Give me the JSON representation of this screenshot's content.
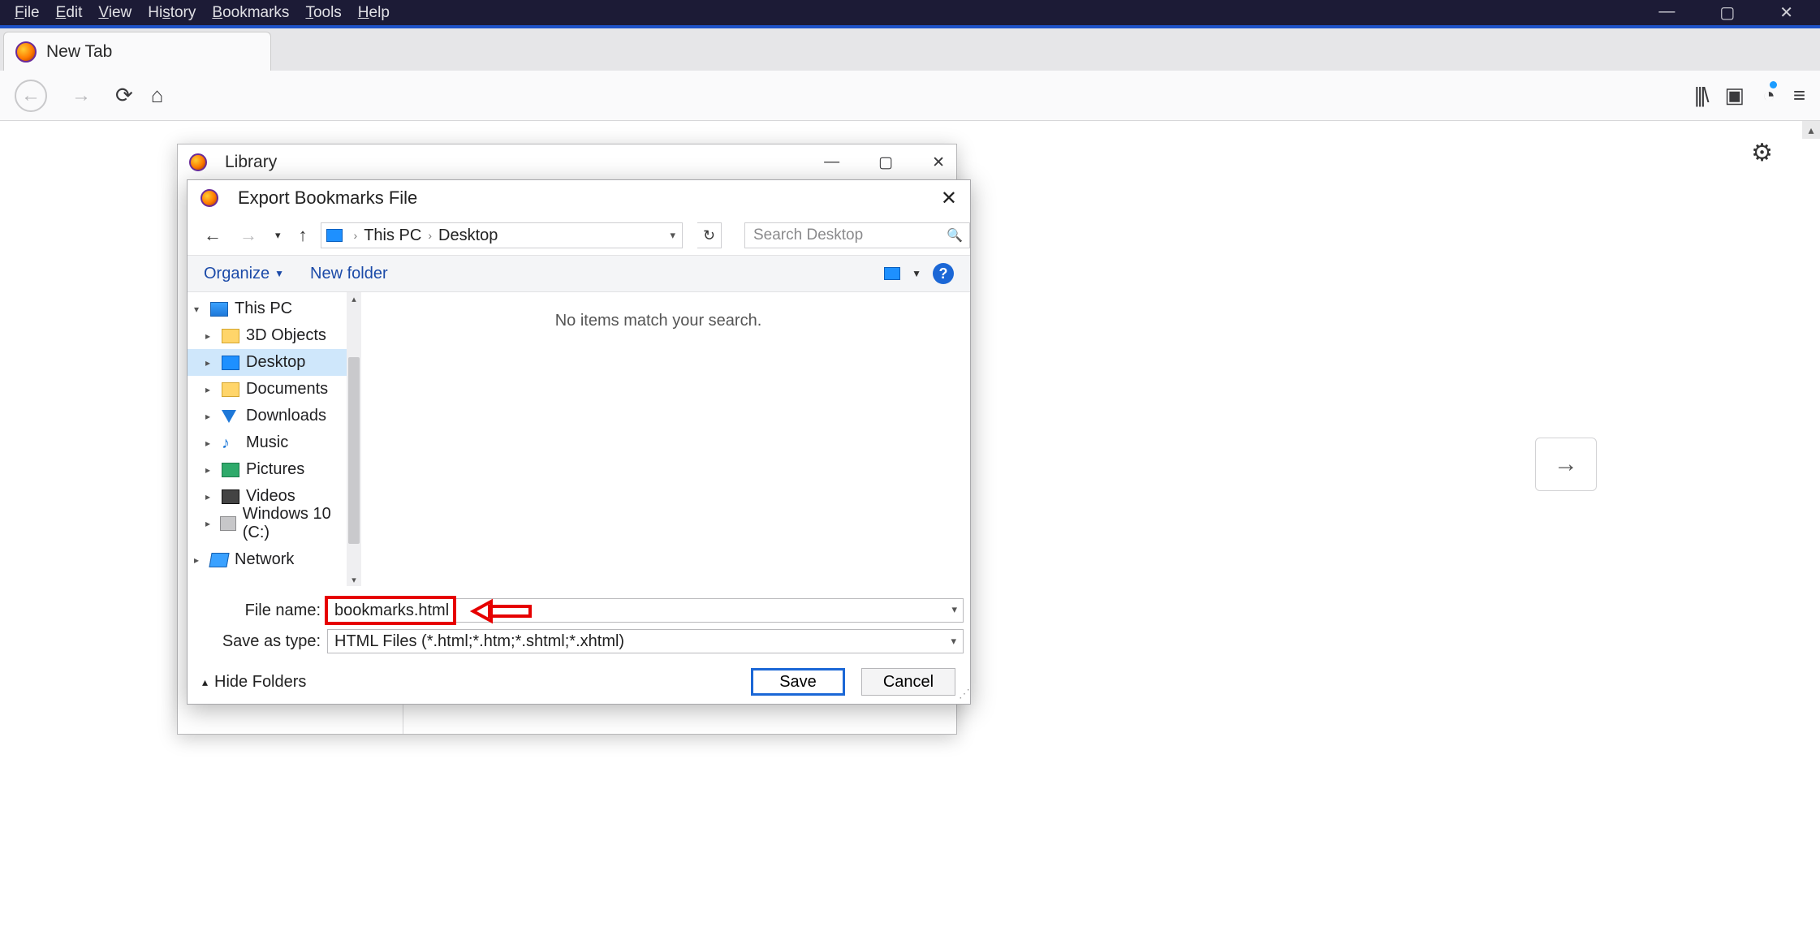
{
  "menubar": {
    "file": "File",
    "edit": "Edit",
    "view": "View",
    "history": "History",
    "bookmarks": "Bookmarks",
    "tools": "Tools",
    "help": "Help"
  },
  "sys": {
    "min": "—",
    "max": "▢",
    "close": "✕"
  },
  "tab": {
    "title": "New Tab"
  },
  "library": {
    "title": "Library",
    "sys": {
      "min": "—",
      "max": "▢",
      "close": "✕"
    }
  },
  "export": {
    "title": "Export Bookmarks File",
    "breadcrumb": {
      "pc": "This PC",
      "desktop": "Desktop"
    },
    "search_placeholder": "Search Desktop",
    "toolbar": {
      "organize": "Organize",
      "newfolder": "New folder"
    },
    "tree": {
      "thispc": "This PC",
      "items": [
        "3D Objects",
        "Desktop",
        "Documents",
        "Downloads",
        "Music",
        "Pictures",
        "Videos",
        "Windows 10 (C:)"
      ],
      "network": "Network"
    },
    "empty": "No items match your search.",
    "form": {
      "filename_label": "File name:",
      "filename_value": "bookmarks.html",
      "saveastype_label": "Save as type:",
      "saveastype_value": "HTML Files (*.html;*.htm;*.shtml;*.xhtml)"
    },
    "footer": {
      "hide": "Hide Folders",
      "save": "Save",
      "cancel": "Cancel"
    }
  }
}
